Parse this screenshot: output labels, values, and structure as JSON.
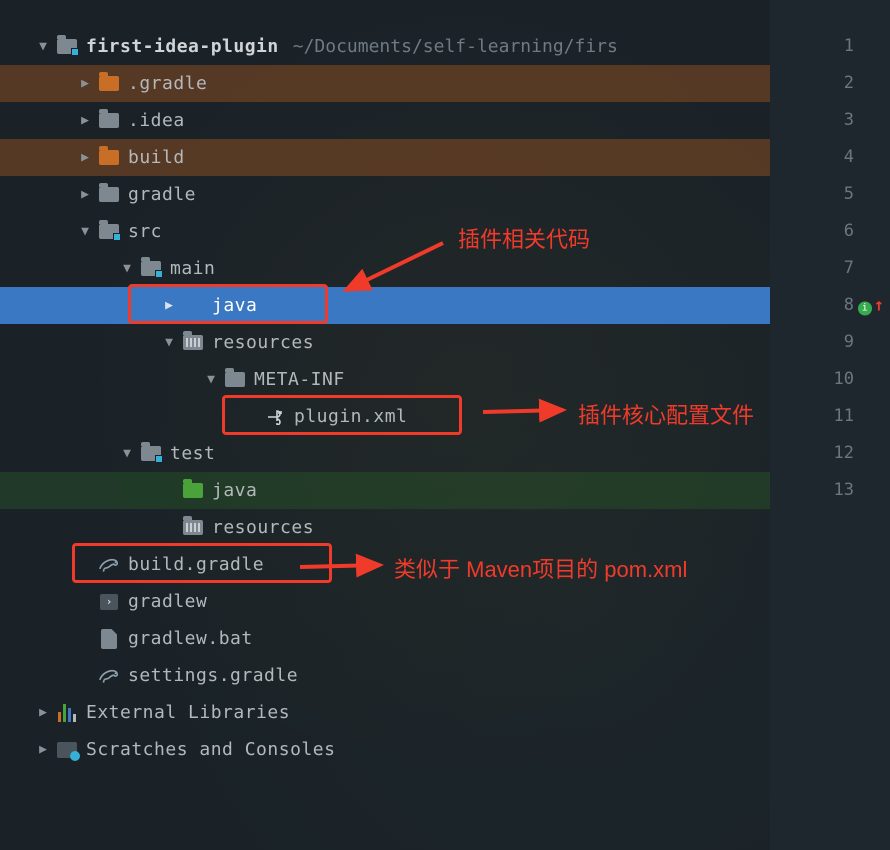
{
  "project": {
    "name": "first-idea-plugin",
    "path": "~/Documents/self-learning/firs"
  },
  "tree": {
    "gradle_dir": ".gradle",
    "idea_dir": ".idea",
    "build_dir": "build",
    "gradle_folder": "gradle",
    "src": "src",
    "main": "main",
    "java": "java",
    "resources": "resources",
    "meta_inf": "META-INF",
    "plugin_xml": "plugin.xml",
    "test": "test",
    "test_java": "java",
    "test_resources": "resources",
    "build_gradle": "build.gradle",
    "gradlew": "gradlew",
    "gradlew_bat": "gradlew.bat",
    "settings_gradle": "settings.gradle",
    "external_libs": "External Libraries",
    "scratches": "Scratches and Consoles"
  },
  "gutter": [
    "1",
    "2",
    "3",
    "4",
    "5",
    "6",
    "7",
    "8",
    "9",
    "10",
    "11",
    "12",
    "13"
  ],
  "annotations": {
    "a1": "插件相关代码",
    "a2": "插件核心配置文件",
    "a3": "类似于 Maven项目的 pom.xml"
  }
}
